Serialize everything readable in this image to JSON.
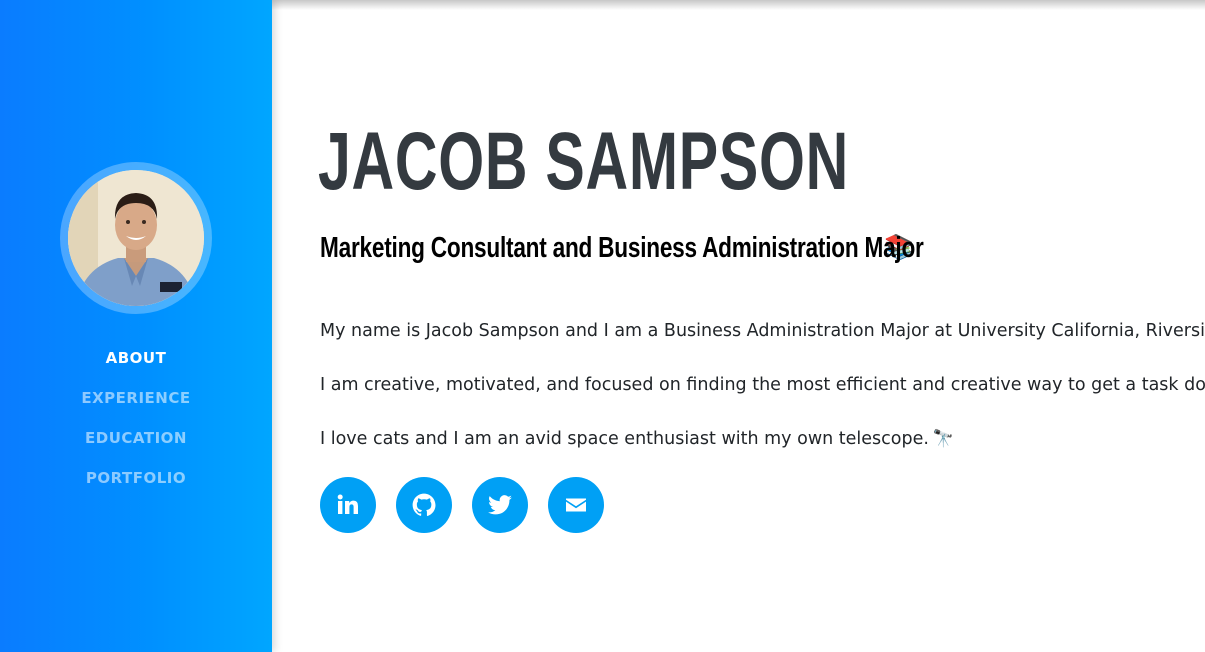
{
  "profile": {
    "name": "JACOB SAMPSON",
    "subtitle": "Marketing Consultant and Business Administration Major",
    "subtitle_emoji": "📚",
    "avatar_alt": "profile-photo"
  },
  "nav": {
    "items": [
      {
        "label": "ABOUT",
        "active": true
      },
      {
        "label": "EXPERIENCE",
        "active": false
      },
      {
        "label": "EDUCATION",
        "active": false
      },
      {
        "label": "PORTFOLIO",
        "active": false
      }
    ]
  },
  "about": {
    "paragraphs": [
      "My name is Jacob Sampson and I am a Business Administration Major at University California, Riverside.",
      "I am creative, motivated, and focused on finding the most efficient and creative way to get a task done.",
      "I love cats and I am an avid space enthusiast with my own telescope."
    ],
    "telescope_emoji": "🔭"
  },
  "socials": [
    {
      "icon": "linkedin-icon"
    },
    {
      "icon": "github-icon"
    },
    {
      "icon": "twitter-icon"
    },
    {
      "icon": "envelope-icon"
    }
  ],
  "colors": {
    "sidebar_start": "#0a7cff",
    "sidebar_end": "#00a6ff",
    "social_button": "#00a0f5",
    "name_text": "#343a40",
    "body_text": "#212529"
  }
}
